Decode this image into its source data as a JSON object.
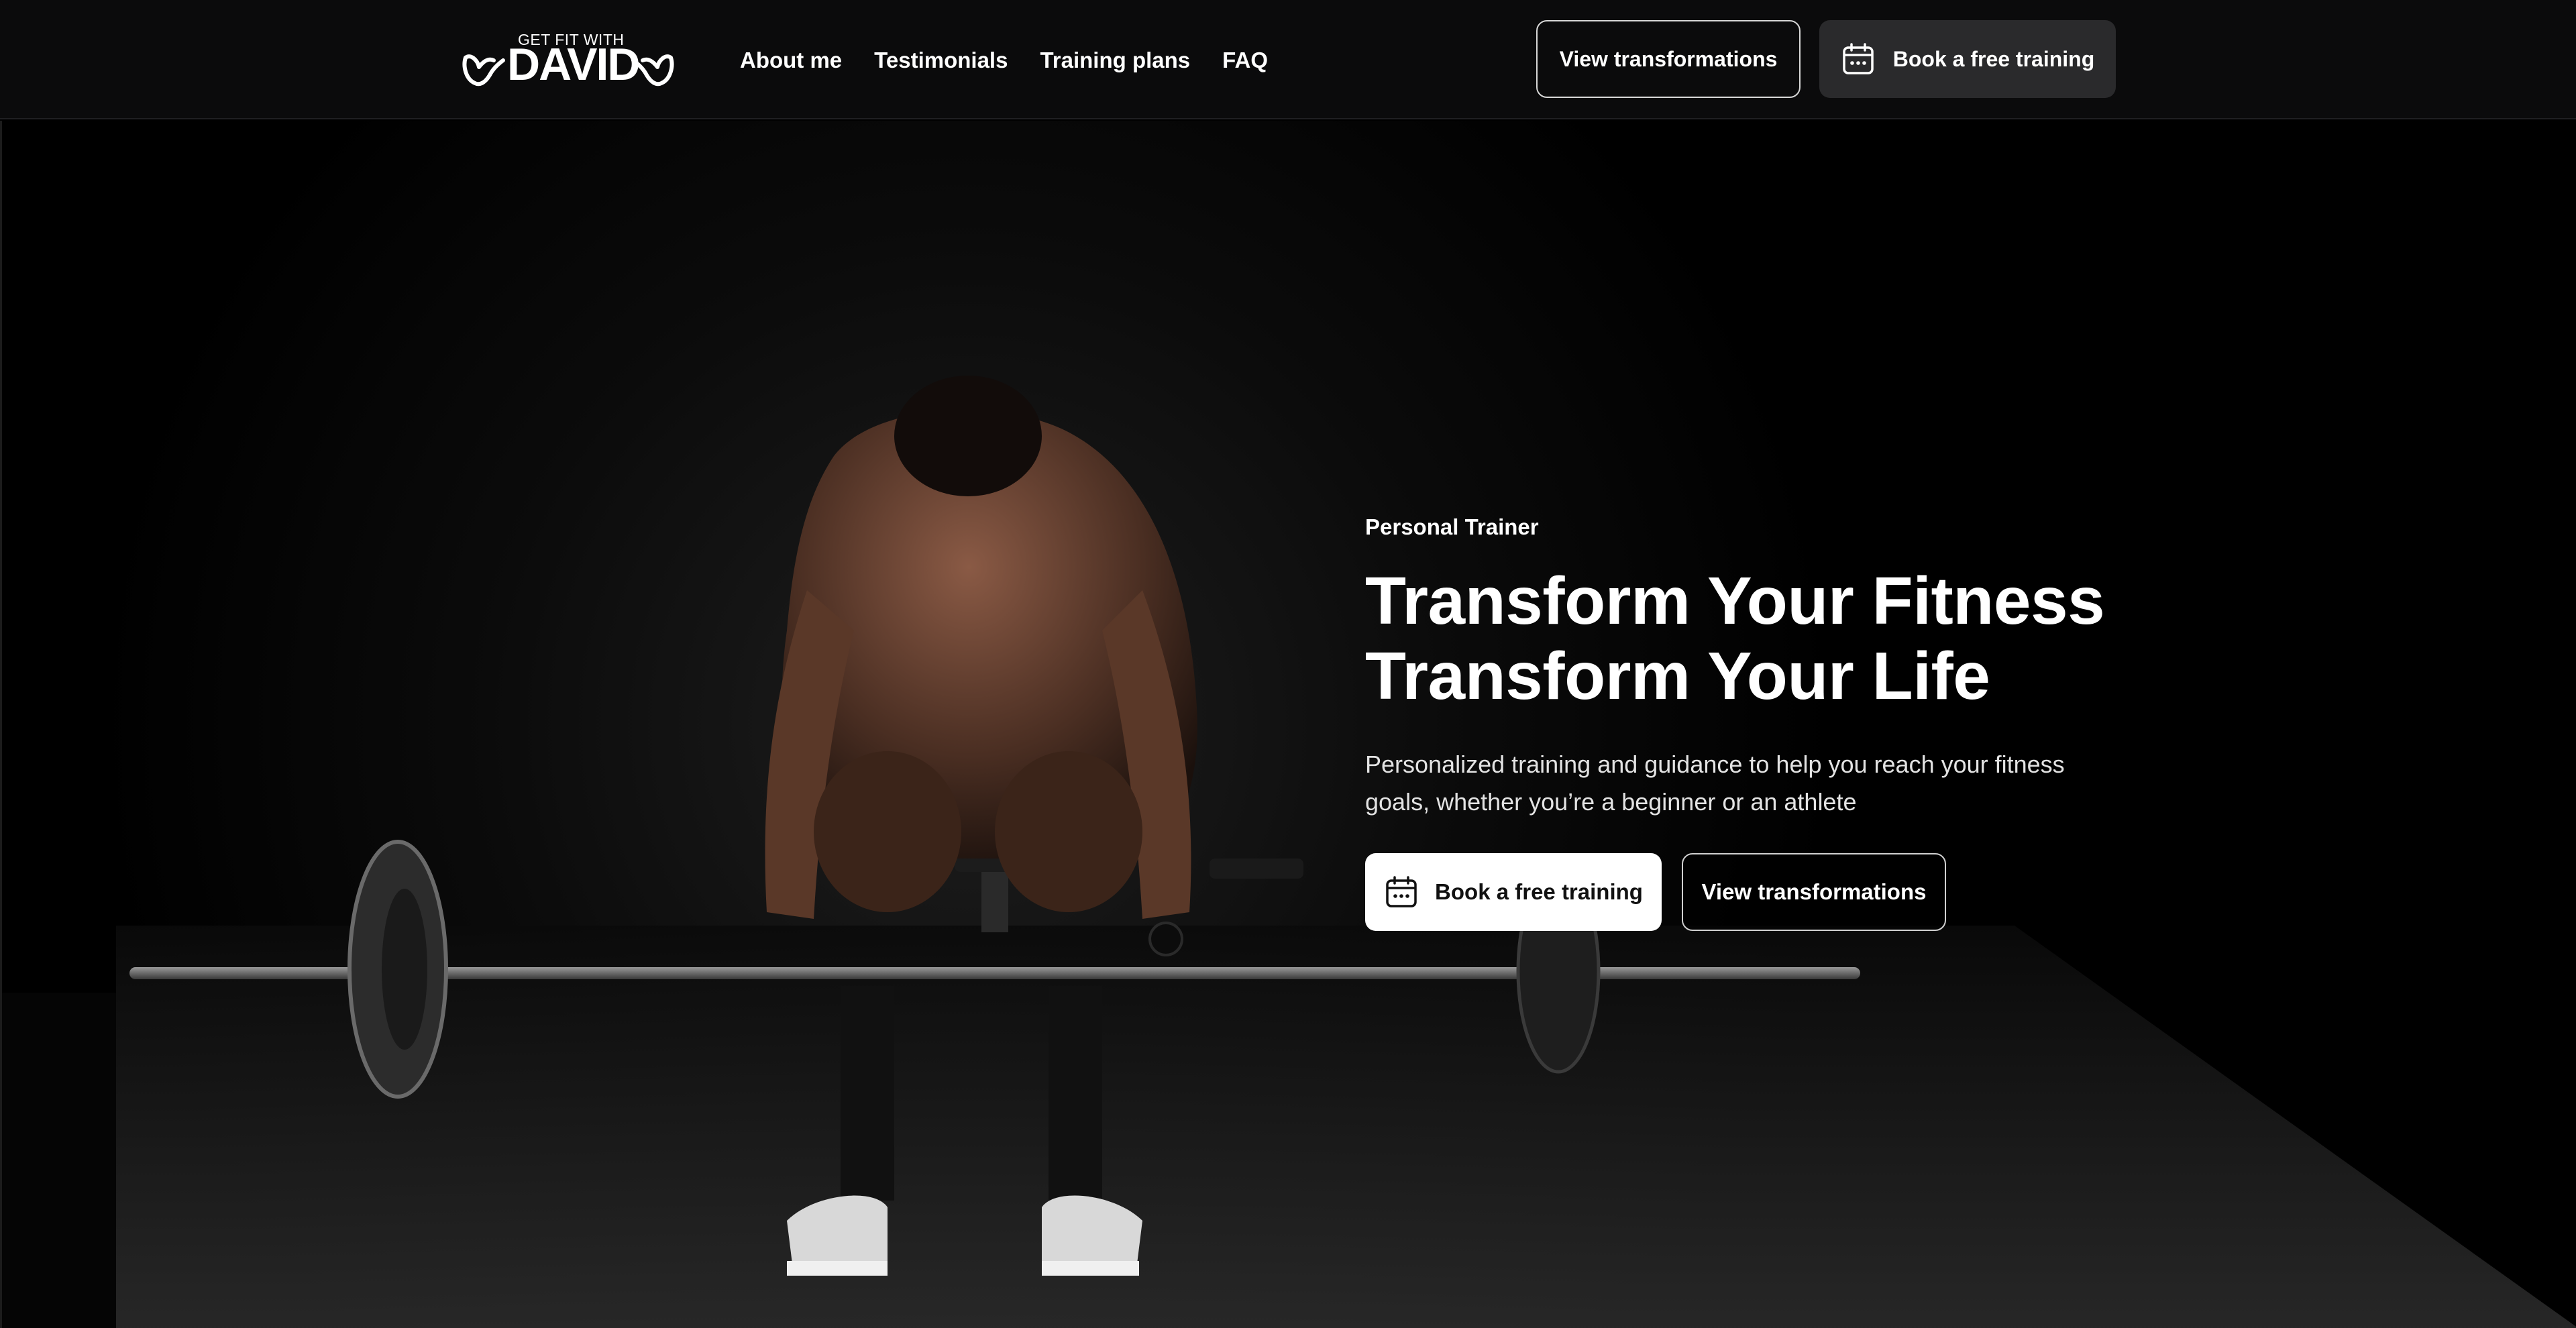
{
  "header": {
    "logo": {
      "small_text": "GET FIT WITH",
      "big_text": "DAVID"
    },
    "nav": [
      {
        "label": "About me"
      },
      {
        "label": "Testimonials"
      },
      {
        "label": "Training plans"
      },
      {
        "label": "FAQ"
      }
    ],
    "view_transformations_label": "View transformations",
    "book_training_label": "Book a free training"
  },
  "hero": {
    "eyebrow": "Personal Trainer",
    "headline_line1": "Transform Your Fitness",
    "headline_line2": "Transform Your Life",
    "subtext": "Personalized training and guidance to help you reach your fitness goals, whether you’re a beginner or an athlete",
    "primary_cta_label": "Book a free training",
    "secondary_cta_label": "View transformations",
    "image_icon": "man-deadlift-photo"
  },
  "icons": {
    "calendar": "calendar-icon",
    "logo_mark": "flexing-arm-icon"
  },
  "colors": {
    "background": "#000000",
    "header_bg": "#0b0b0c",
    "dark_button": "#2a2a2c",
    "text": "#ffffff"
  }
}
